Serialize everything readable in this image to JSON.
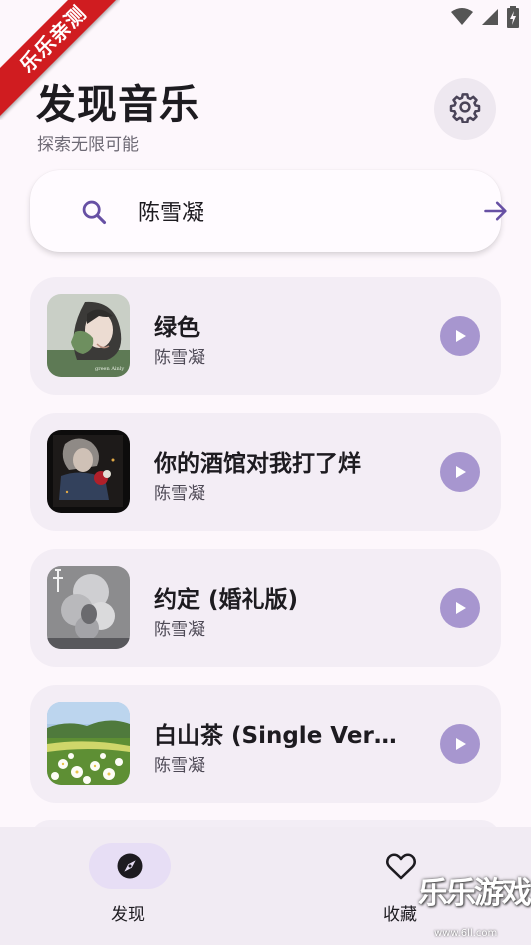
{
  "ribbon": {
    "text": "乐乐亲测"
  },
  "header": {
    "title": "发现音乐",
    "subtitle": "探索无限可能"
  },
  "search": {
    "value": "陈雪凝"
  },
  "songs": [
    {
      "title": "绿色",
      "artist": "陈雪凝"
    },
    {
      "title": "你的酒馆对我打了烊",
      "artist": "陈雪凝"
    },
    {
      "title": "约定 (婚礼版)",
      "artist": "陈雪凝"
    },
    {
      "title": "白山茶 (Single Versi…",
      "artist": "陈雪凝"
    }
  ],
  "nav": {
    "discover_label": "发现",
    "favorites_label": "收藏"
  },
  "watermark": {
    "text": "乐乐游戏",
    "url": "www.6ll.com"
  },
  "icons": {
    "settings": "gear-icon",
    "search": "search-icon",
    "submit": "arrow-right-icon",
    "play": "play-icon",
    "discover": "compass-icon",
    "favorites": "heart-icon",
    "wifi": "wifi-icon",
    "signal": "signal-icon",
    "battery": "battery-icon"
  },
  "colors": {
    "accent": "#6750a4",
    "play": "#a796cf",
    "card": "#f3edf5",
    "background": "#fdf7fc",
    "ribbon": "#d01c20"
  }
}
